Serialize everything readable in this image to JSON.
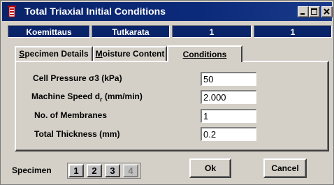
{
  "window": {
    "title": "Total Triaxial Initial Conditions"
  },
  "info_bar": {
    "cells": [
      "Koemittaus",
      "Tutkarata",
      "1",
      "1"
    ]
  },
  "tabs": [
    {
      "prefix": "",
      "accel": "S",
      "rest": "pecimen Details"
    },
    {
      "prefix": "",
      "accel": "M",
      "rest": "oisture Content"
    },
    {
      "prefix": "",
      "accel": "C",
      "rest": "onditions"
    }
  ],
  "fields": {
    "cell_pressure": {
      "label": "Cell Pressure σ3 (kPa)",
      "value": "50"
    },
    "machine_speed": {
      "label_main": "Machine Speed d",
      "label_sub": "r",
      "label_tail": " (mm/min)",
      "value": "2.000"
    },
    "membranes": {
      "label": "No. of Membranes",
      "value": "1"
    },
    "thickness": {
      "label": "Total Thickness (mm)",
      "value": "0.2"
    }
  },
  "specimen": {
    "label": "Specimen",
    "buttons": [
      "1",
      "2",
      "3",
      "4"
    ]
  },
  "buttons": {
    "ok": "Ok",
    "cancel": "Cancel"
  },
  "colors": {
    "title_bar": "#0a246a",
    "face": "#d4d0c8"
  }
}
